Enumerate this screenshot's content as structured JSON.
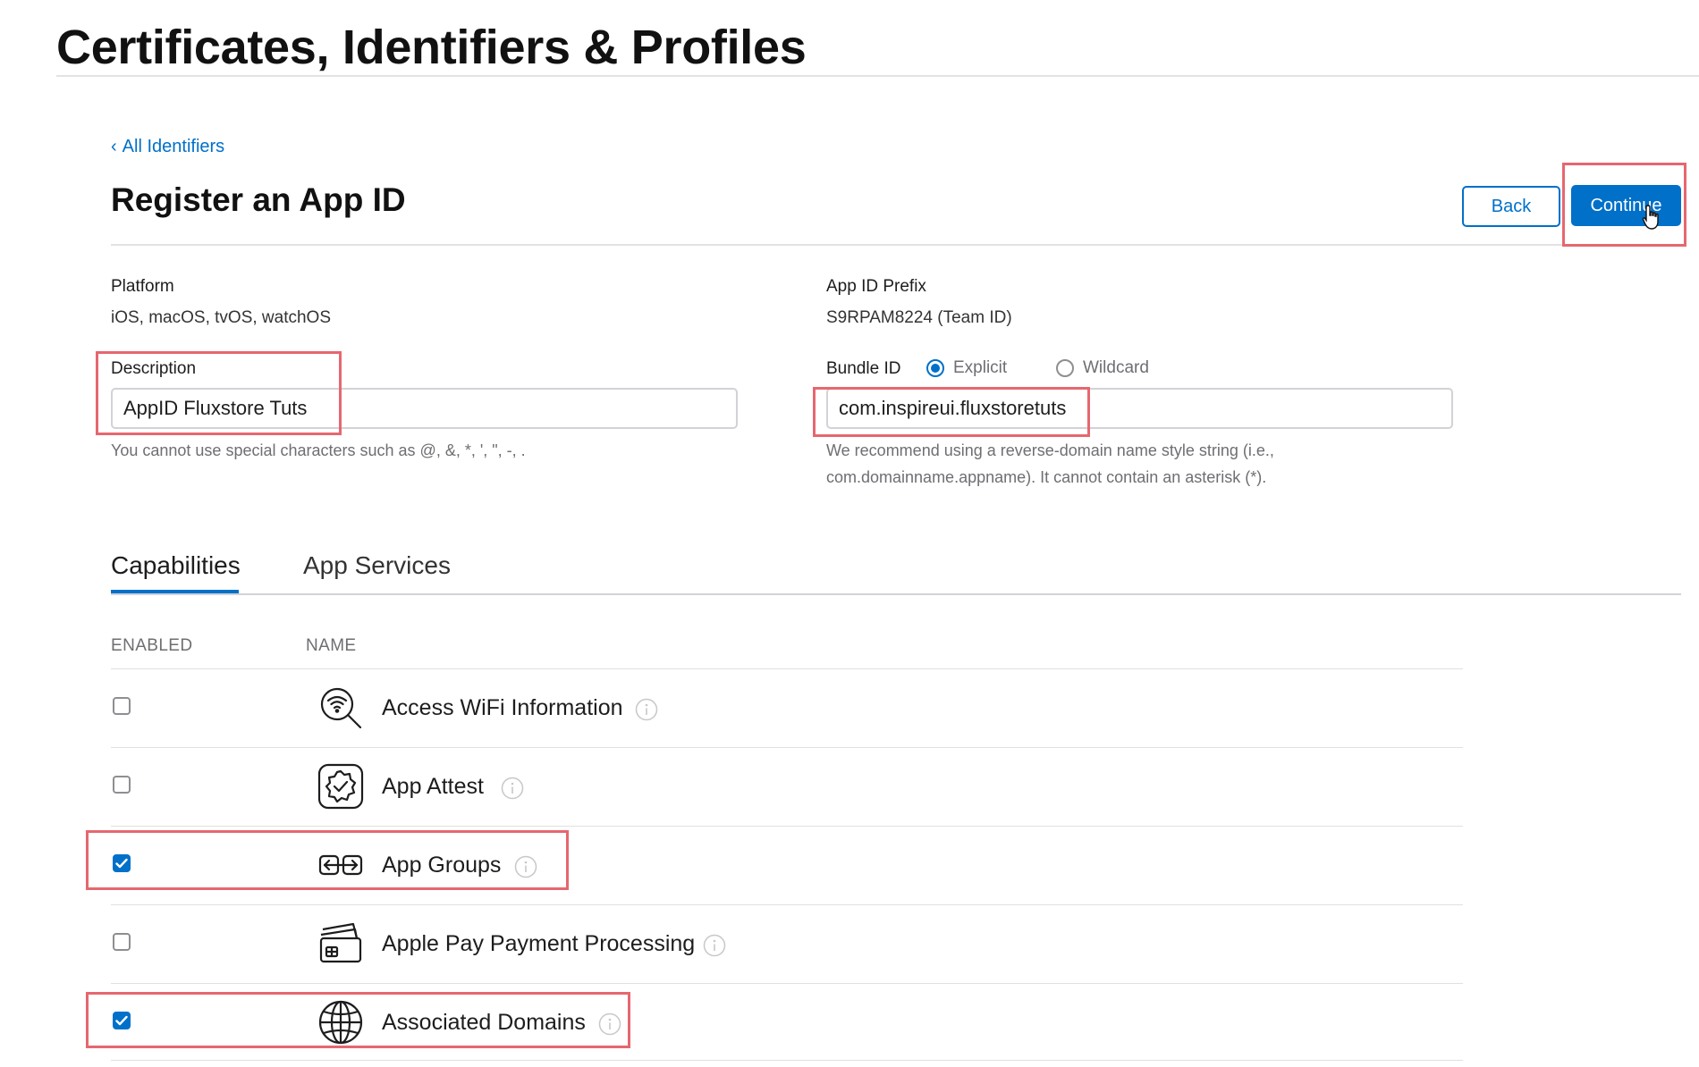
{
  "header": {
    "title": "Certificates, Identifiers & Profiles"
  },
  "nav": {
    "back_link": "All Identifiers"
  },
  "register": {
    "title": "Register an App ID",
    "back_button": "Back",
    "continue_button": "Continue"
  },
  "platform": {
    "label": "Platform",
    "value": "iOS, macOS, tvOS, watchOS"
  },
  "prefix": {
    "label": "App ID Prefix",
    "value": "S9RPAM8224 (Team ID)"
  },
  "description": {
    "label": "Description",
    "value": "AppID Fluxstore Tuts",
    "hint": "You cannot use special characters such as @, &, *, ', \", -, ."
  },
  "bundle": {
    "label": "Bundle ID",
    "options": [
      {
        "label": "Explicit",
        "selected": true
      },
      {
        "label": "Wildcard",
        "selected": false
      }
    ],
    "value": "com.inspireui.fluxstoretuts",
    "hint_line1": "We recommend using a reverse-domain name style string (i.e.,",
    "hint_line2": "com.domainname.appname). It cannot contain an asterisk (*)."
  },
  "tabs": [
    {
      "label": "Capabilities",
      "active": true
    },
    {
      "label": "App Services",
      "active": false
    }
  ],
  "table": {
    "columns": [
      "ENABLED",
      "NAME"
    ],
    "rows": [
      {
        "name": "Access WiFi Information",
        "enabled": false,
        "icon": "wifi-search-icon"
      },
      {
        "name": "App Attest",
        "enabled": false,
        "icon": "verified-badge-icon"
      },
      {
        "name": "App Groups",
        "enabled": true,
        "icon": "app-groups-icon"
      },
      {
        "name": "Apple Pay Payment Processing",
        "enabled": false,
        "icon": "payment-cards-icon"
      },
      {
        "name": "Associated Domains",
        "enabled": true,
        "icon": "globe-icon"
      }
    ]
  },
  "colors": {
    "accent": "#0070c9",
    "highlight": "#e6676f"
  }
}
